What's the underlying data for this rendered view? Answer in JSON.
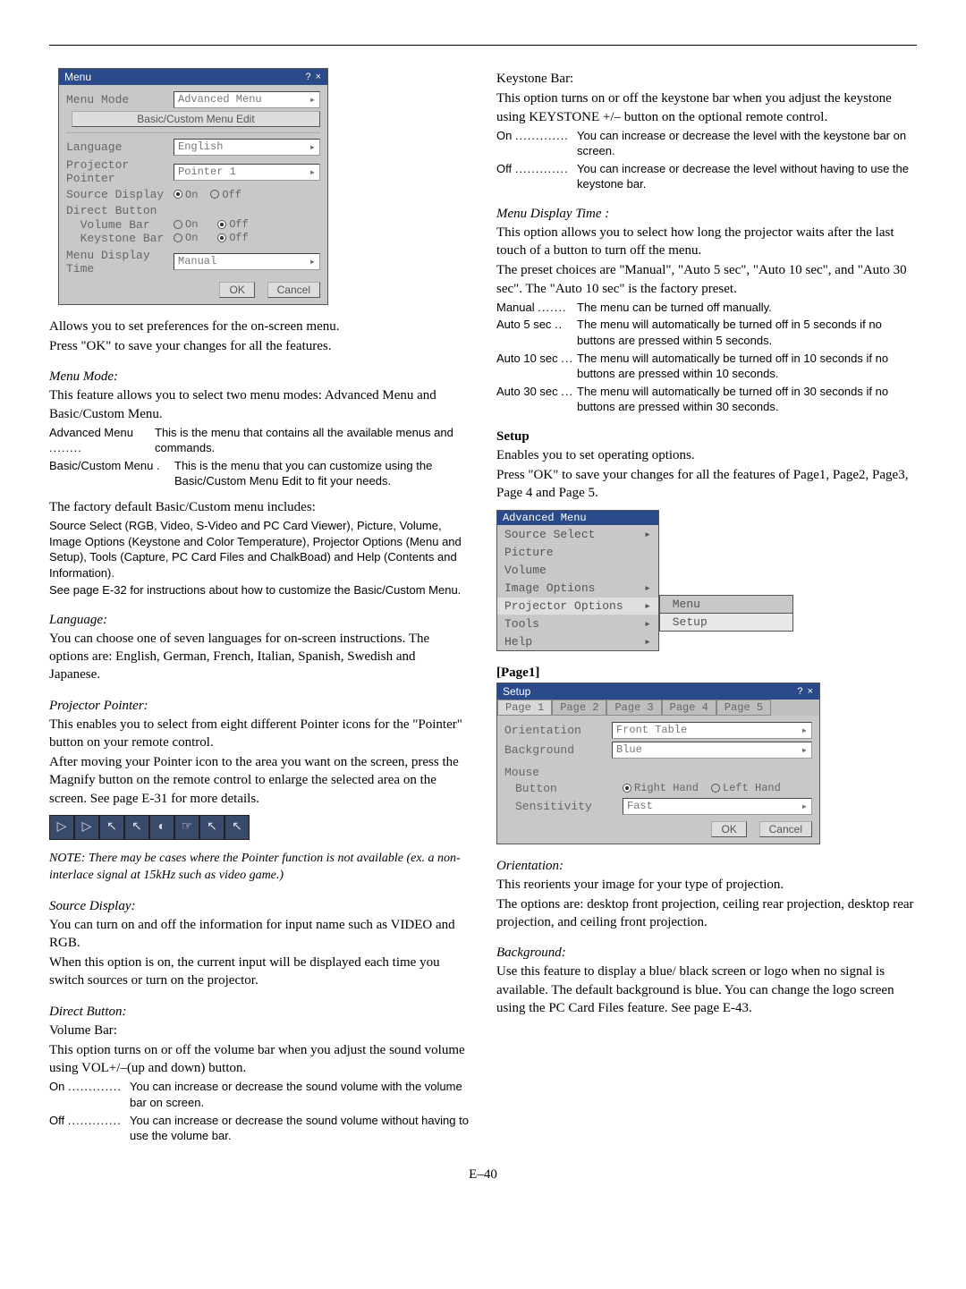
{
  "menu_dialog": {
    "title": "Menu",
    "winbtns": "? ×",
    "menu_mode_label": "Menu Mode",
    "menu_mode_value": "Advanced Menu",
    "edit_btn": "Basic/Custom Menu Edit",
    "language_label": "Language",
    "language_value": "English",
    "pointer_label": "Projector Pointer",
    "pointer_value": "Pointer 1",
    "source_disp_label": "Source Display",
    "sd_on": "On",
    "sd_off": "Off",
    "direct_btn_label": "Direct Button",
    "vol_bar_label": "Volume Bar",
    "key_bar_label": "Keystone Bar",
    "vb_on": "On",
    "vb_off": "Off",
    "kb_on": "On",
    "kb_off": "Off",
    "mdt_label": "Menu Display Time",
    "mdt_value": "Manual",
    "ok": "OK",
    "cancel": "Cancel"
  },
  "col1": {
    "intro1": "Allows you to set preferences for the on-screen menu.",
    "intro2": "Press \"OK\" to save your changes for all the features.",
    "menu_mode_h": "Menu Mode:",
    "menu_mode_p": "This feature allows you to select two menu modes: Advanced Menu and Basic/Custom Menu.",
    "adv_term": "Advanced Menu",
    "adv_def": "This is the menu that contains all the available menus and commands.",
    "bc_term": "Basic/Custom Menu",
    "bc_def": "This is the menu that you can customize using the Basic/Custom Menu Edit to fit your needs.",
    "factory_line": "The factory default Basic/Custom menu includes:",
    "factory_small": "Source Select (RGB, Video, S-Video and PC Card Viewer), Picture, Volume, Image Options (Keystone and Color Temperature), Projector Options (Menu and Setup), Tools (Capture, PC Card Files and ChalkBoad) and Help (Contents and Information).",
    "see_e32": "See page E-32 for instructions about how to customize the Basic/Custom Menu.",
    "lang_h": "Language:",
    "lang_p": "You can choose one of seven languages for on-screen instructions. The options are: English, German, French, Italian, Spanish, Swedish and Japanese.",
    "pp_h": "Projector Pointer:",
    "pp_p1": "This enables you to select from eight different Pointer icons for the \"Pointer\" button on your remote control.",
    "pp_p2": "After moving your Pointer icon to the area you want on the screen, press the Magnify button on the remote control to enlarge the selected area on the screen. See page E-31 for more details.",
    "pp_note": "NOTE: There may be cases where the Pointer function is not available (ex. a non-interlace signal at 15kHz such as video game.)",
    "sd_h": "Source Display:",
    "sd_p1": "You can turn on and off the information for input name such as VIDEO and RGB.",
    "sd_p2": "When this option is on, the current input will be displayed each time you switch sources or turn on the projector.",
    "db_h": "Direct Button:",
    "db_vb": "Volume Bar:",
    "db_vb_p": "This option turns on or off the volume bar when you adjust the sound volume using VOL+/–(up and down) button.",
    "db_on_term": "On",
    "db_on_def": "You can increase or decrease the sound volume with the volume bar on screen.",
    "db_off_term": "Off",
    "db_off_def": "You can increase or decrease the sound volume without having to use the volume bar."
  },
  "col2": {
    "kb_h": "Keystone Bar:",
    "kb_p": "This option turns on or off the keystone bar when you adjust the keystone using KEYSTONE +/– button on the optional remote control.",
    "kb_on_term": "On",
    "kb_on_def": "You can increase or decrease the level with the keystone bar on screen.",
    "kb_off_term": "Off",
    "kb_off_def": "You can increase or decrease the level without having to use the keystone bar.",
    "mdt_h": "Menu Display Time :",
    "mdt_p1": "This option allows you to select how long the projector waits after the last touch of a button to turn off the menu.",
    "mdt_p2": "The preset choices are \"Manual\", \"Auto 5 sec\", \"Auto 10 sec\", and \"Auto 30 sec\". The \"Auto 10 sec\" is the factory preset.",
    "mdt_manual_t": "Manual",
    "mdt_manual_d": "The menu can be turned off manually.",
    "mdt_a5_t": "Auto 5 sec",
    "mdt_a5_d": "The menu will automatically be turned off in 5 seconds if no buttons are pressed within 5 seconds.",
    "mdt_a10_t": "Auto 10 sec",
    "mdt_a10_d": "The menu will automatically be turned off in 10 seconds if no buttons are pressed within 10 seconds.",
    "mdt_a30_t": "Auto 30 sec",
    "mdt_a30_d": "The menu will automatically be turned off in 30 seconds if no buttons are pressed within 30 seconds.",
    "setup_h": "Setup",
    "setup_p1": "Enables you to set operating options.",
    "setup_p2": "Press \"OK\" to save your changes for all the features of Page1, Page2, Page3, Page 4 and Page 5.",
    "adv_menu_title": "Advanced Menu",
    "adv_items": [
      "Source Select",
      "Picture",
      "Volume",
      "Image Options",
      "Projector Options",
      "Tools",
      "Help"
    ],
    "sub_menu": "Menu",
    "sub_setup": "Setup",
    "page1_h": "[Page1]",
    "setup_title": "Setup",
    "tabs": [
      "Page 1",
      "Page 2",
      "Page 3",
      "Page 4",
      "Page 5"
    ],
    "orient_label": "Orientation",
    "orient_value": "Front Table",
    "bg_label": "Background",
    "bg_value": "Blue",
    "mouse_label": "Mouse",
    "mouse_btn_label": "Button",
    "mouse_right": "Right Hand",
    "mouse_left": "Left Hand",
    "sens_label": "Sensitivity",
    "sens_value": "Fast",
    "ok": "OK",
    "cancel": "Cancel",
    "orient_h": "Orientation:",
    "orient_p1": "This reorients your image for your type of projection.",
    "orient_p2": "The options are: desktop front projection, ceiling rear projection, desktop rear projection, and ceiling front projection.",
    "bg_h": "Background:",
    "bg_p": "Use this feature to display a blue/ black screen or logo when no signal is available. The default background is blue. You can change the logo screen using the PC Card Files feature. See page E-43."
  },
  "page_num": "E–40"
}
